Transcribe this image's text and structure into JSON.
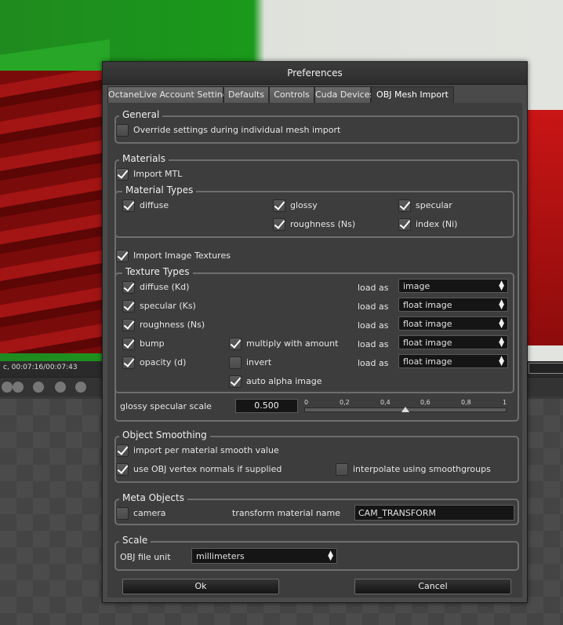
{
  "background": {
    "timecode": "c, 00:07:16/00:07:43"
  },
  "dialog": {
    "title": "Preferences",
    "tabs": [
      {
        "label": "OctaneLive Account Settings"
      },
      {
        "label": "Defaults"
      },
      {
        "label": "Controls"
      },
      {
        "label": "Cuda Devices"
      },
      {
        "label": "OBJ Mesh Import",
        "active": true
      }
    ],
    "general": {
      "title": "General",
      "override": {
        "label": "Override settings during individual mesh import",
        "checked": false
      }
    },
    "materials": {
      "title": "Materials",
      "import_mtl": {
        "label": "Import MTL",
        "checked": true
      },
      "material_types": {
        "title": "Material Types",
        "diffuse": {
          "label": "diffuse",
          "checked": true
        },
        "glossy": {
          "label": "glossy",
          "checked": true
        },
        "specular": {
          "label": "specular",
          "checked": true
        },
        "roughness": {
          "label": "roughness (Ns)",
          "checked": true
        },
        "index": {
          "label": "index (Ni)",
          "checked": true
        }
      },
      "import_textures": {
        "label": "Import Image Textures",
        "checked": true
      },
      "texture_types": {
        "title": "Texture Types",
        "load_as_label": "load as",
        "rows": [
          {
            "label": "diffuse (Kd)",
            "checked": true,
            "load_as": "image"
          },
          {
            "label": "specular (Ks)",
            "checked": true,
            "load_as": "float image"
          },
          {
            "label": "roughness (Ns)",
            "checked": true,
            "load_as": "float image"
          },
          {
            "label": "bump",
            "checked": true,
            "load_as": "float image"
          },
          {
            "label": "opacity (d)",
            "checked": true,
            "load_as": "float image"
          }
        ],
        "multiply": {
          "label": "multiply with amount",
          "checked": true
        },
        "invert": {
          "label": "invert",
          "checked": false
        },
        "auto_alpha": {
          "label": "auto alpha image",
          "checked": true
        }
      },
      "glossy_scale": {
        "label": "glossy specular scale",
        "value": "0.500",
        "slider_fraction": 0.5,
        "ticks": [
          "0",
          "0,2",
          "0,4",
          "0,6",
          "0,8",
          "1"
        ]
      }
    },
    "object_smoothing": {
      "title": "Object Smoothing",
      "per_material": {
        "label": "import per material smooth value",
        "checked": true
      },
      "vertex_normals": {
        "label": "use OBJ vertex normals if supplied",
        "checked": true
      },
      "smoothgroups": {
        "label": "interpolate using smoothgroups",
        "checked": false
      }
    },
    "meta_objects": {
      "title": "Meta Objects",
      "camera": {
        "label": "camera",
        "checked": false
      },
      "transform_label": "transform material name",
      "transform_value": "CAM_TRANSFORM"
    },
    "scale": {
      "title": "Scale",
      "unit_label": "OBJ file unit",
      "unit_value": "millimeters"
    },
    "ok_label": "Ok",
    "cancel_label": "Cancel"
  }
}
